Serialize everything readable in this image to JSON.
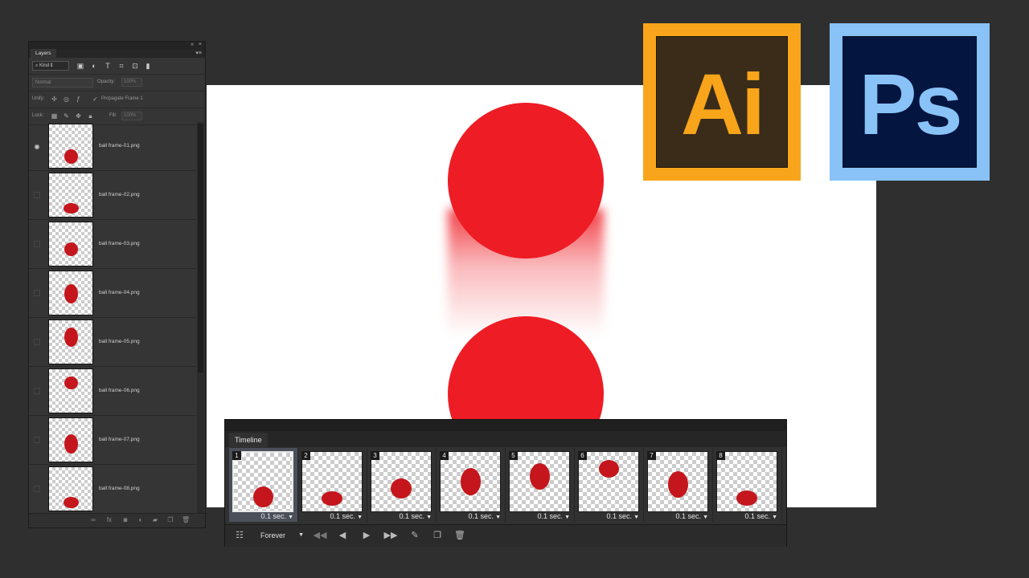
{
  "logos": {
    "ai": "Ai",
    "ps": "Ps"
  },
  "colors": {
    "ball": "#ee1c24",
    "ai_accent": "#f8a51b",
    "ps_accent": "#88c2f7",
    "panel_bg": "#353535"
  },
  "layers_panel": {
    "tab_label": "Layers",
    "filter_kind": "Kind",
    "blend_mode": "Normal",
    "opacity_label": "Opacity:",
    "opacity_value": "100%",
    "unify_label": "Unify:",
    "propagate_label": "Propagate Frame 1",
    "lock_label": "Lock:",
    "fill_label": "Fill:",
    "fill_value": "100%",
    "layers": [
      {
        "name": "ball frame-01.png",
        "visible": true
      },
      {
        "name": "ball frame-02.png",
        "visible": false
      },
      {
        "name": "ball frame-03.png",
        "visible": false
      },
      {
        "name": "ball frame-04.png",
        "visible": false
      },
      {
        "name": "ball frame-05.png",
        "visible": false
      },
      {
        "name": "ball frame-06.png",
        "visible": false
      },
      {
        "name": "ball frame-07.png",
        "visible": false
      },
      {
        "name": "ball frame-08.png",
        "visible": false
      }
    ]
  },
  "timeline": {
    "tab_label": "Timeline",
    "loop_option": "Forever",
    "frames": [
      {
        "number": "1",
        "duration": "0.1 sec."
      },
      {
        "number": "2",
        "duration": "0.1 sec."
      },
      {
        "number": "3",
        "duration": "0.1 sec."
      },
      {
        "number": "4",
        "duration": "0.1 sec."
      },
      {
        "number": "5",
        "duration": "0.1 sec."
      },
      {
        "number": "6",
        "duration": "0.1 sec."
      },
      {
        "number": "7",
        "duration": "0.1 sec."
      },
      {
        "number": "8",
        "duration": "0.1 sec."
      }
    ],
    "selected_frame": "1"
  }
}
